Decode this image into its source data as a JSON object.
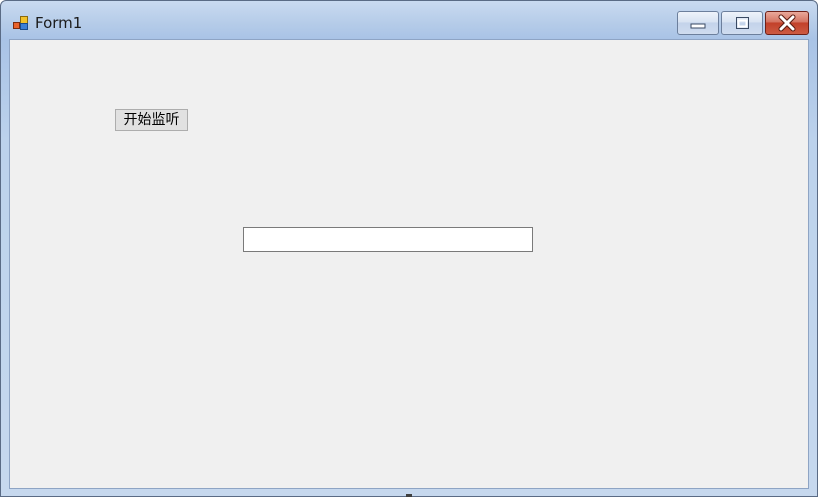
{
  "window": {
    "title": "Form1",
    "icon": "winforms-app-icon"
  },
  "caption_buttons": {
    "minimize": "minimize-icon",
    "maximize": "maximize-icon",
    "close": "close-icon"
  },
  "form": {
    "start_button_label": "开始监听",
    "text_field_value": ""
  },
  "colors": {
    "client_bg": "#f0f0f0",
    "close_button": "#c2412a",
    "frame": "#b4cbe8"
  }
}
